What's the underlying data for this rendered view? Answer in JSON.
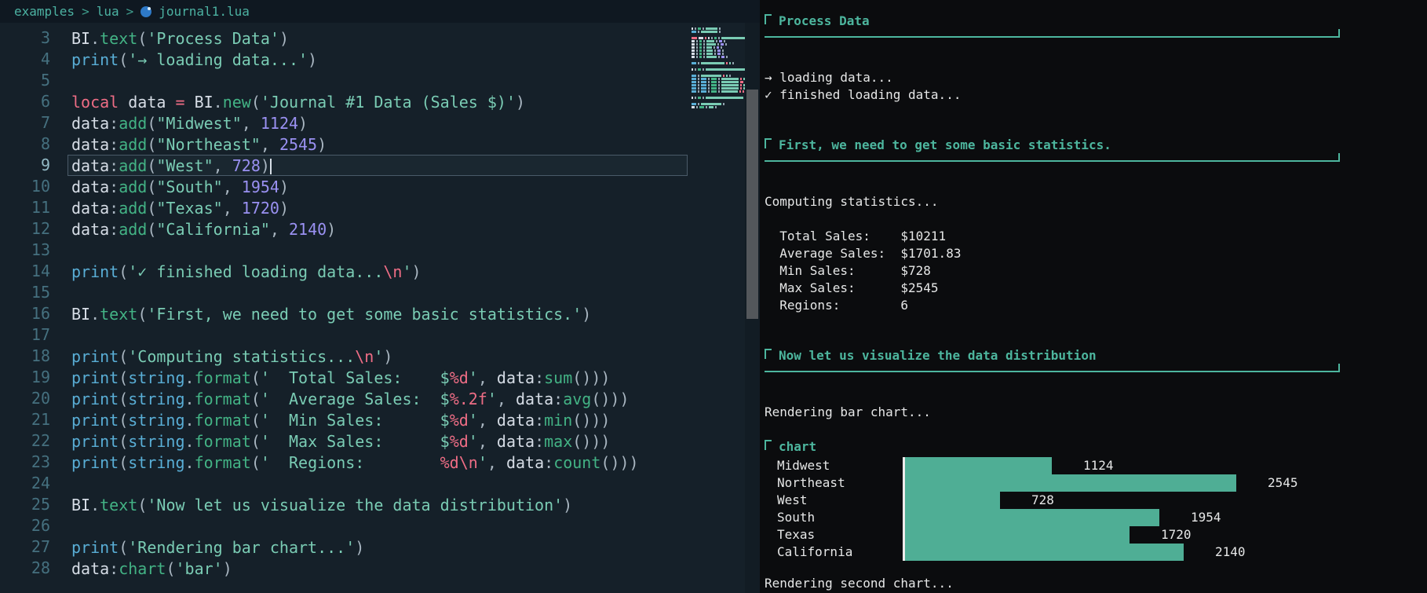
{
  "theme": {
    "editor_bg": "#152029",
    "output_bg": "#0b0c0e",
    "accent_teal": "#4db69e",
    "bar_color": "#4fae95",
    "keyword_pink": "#ee6d85",
    "function_green": "#43b385",
    "string_teal": "#7accb4",
    "builtin_blue": "#59aed6",
    "number_purple": "#9a91f2"
  },
  "breadcrumb": {
    "path": [
      "examples",
      "lua"
    ],
    "separator": ">",
    "file": "journal1.lua"
  },
  "editor": {
    "active_line": 9,
    "lines": [
      {
        "n": 3,
        "tokens": [
          [
            "id",
            "BI"
          ],
          [
            "p",
            "."
          ],
          [
            "fn",
            "text"
          ],
          [
            "p",
            "("
          ],
          [
            "str",
            "'Process Data'"
          ],
          [
            "p",
            ")"
          ]
        ]
      },
      {
        "n": 4,
        "tokens": [
          [
            "b",
            "print"
          ],
          [
            "p",
            "("
          ],
          [
            "str",
            "'→ loading data...'"
          ],
          [
            "p",
            ")"
          ]
        ]
      },
      {
        "n": 5,
        "tokens": []
      },
      {
        "n": 6,
        "tokens": [
          [
            "kw",
            "local "
          ],
          [
            "id",
            "data "
          ],
          [
            "kw",
            "= "
          ],
          [
            "id",
            "BI"
          ],
          [
            "p",
            "."
          ],
          [
            "fn",
            "new"
          ],
          [
            "p",
            "("
          ],
          [
            "str",
            "'Journal #1 Data (Sales $)'"
          ],
          [
            "p",
            ")"
          ]
        ]
      },
      {
        "n": 7,
        "tokens": [
          [
            "id",
            "data"
          ],
          [
            "p",
            ":"
          ],
          [
            "fn",
            "add"
          ],
          [
            "p",
            "("
          ],
          [
            "str",
            "\"Midwest\""
          ],
          [
            "p",
            ", "
          ],
          [
            "num",
            "1124"
          ],
          [
            "p",
            ")"
          ]
        ]
      },
      {
        "n": 8,
        "tokens": [
          [
            "id",
            "data"
          ],
          [
            "p",
            ":"
          ],
          [
            "fn",
            "add"
          ],
          [
            "p",
            "("
          ],
          [
            "str",
            "\"Northeast\""
          ],
          [
            "p",
            ", "
          ],
          [
            "num",
            "2545"
          ],
          [
            "p",
            ")"
          ]
        ]
      },
      {
        "n": 9,
        "cursor": true,
        "tokens": [
          [
            "id",
            "data"
          ],
          [
            "p",
            ":"
          ],
          [
            "fn",
            "add"
          ],
          [
            "p",
            "("
          ],
          [
            "str",
            "\"West\""
          ],
          [
            "p",
            ", "
          ],
          [
            "num",
            "728"
          ],
          [
            "p",
            ")"
          ]
        ]
      },
      {
        "n": 10,
        "tokens": [
          [
            "id",
            "data"
          ],
          [
            "p",
            ":"
          ],
          [
            "fn",
            "add"
          ],
          [
            "p",
            "("
          ],
          [
            "str",
            "\"South\""
          ],
          [
            "p",
            ", "
          ],
          [
            "num",
            "1954"
          ],
          [
            "p",
            ")"
          ]
        ]
      },
      {
        "n": 11,
        "tokens": [
          [
            "id",
            "data"
          ],
          [
            "p",
            ":"
          ],
          [
            "fn",
            "add"
          ],
          [
            "p",
            "("
          ],
          [
            "str",
            "\"Texas\""
          ],
          [
            "p",
            ", "
          ],
          [
            "num",
            "1720"
          ],
          [
            "p",
            ")"
          ]
        ]
      },
      {
        "n": 12,
        "tokens": [
          [
            "id",
            "data"
          ],
          [
            "p",
            ":"
          ],
          [
            "fn",
            "add"
          ],
          [
            "p",
            "("
          ],
          [
            "str",
            "\"California\""
          ],
          [
            "p",
            ", "
          ],
          [
            "num",
            "2140"
          ],
          [
            "p",
            ")"
          ]
        ]
      },
      {
        "n": 13,
        "tokens": []
      },
      {
        "n": 14,
        "tokens": [
          [
            "b",
            "print"
          ],
          [
            "p",
            "("
          ],
          [
            "str",
            "'✓ finished loading data..."
          ],
          [
            "esc",
            "\\n"
          ],
          [
            "str",
            "'"
          ],
          [
            "p",
            ")"
          ]
        ]
      },
      {
        "n": 15,
        "tokens": []
      },
      {
        "n": 16,
        "tokens": [
          [
            "id",
            "BI"
          ],
          [
            "p",
            "."
          ],
          [
            "fn",
            "text"
          ],
          [
            "p",
            "("
          ],
          [
            "str",
            "'First, we need to get some basic statistics.'"
          ],
          [
            "p",
            ")"
          ]
        ]
      },
      {
        "n": 17,
        "tokens": []
      },
      {
        "n": 18,
        "tokens": [
          [
            "b",
            "print"
          ],
          [
            "p",
            "("
          ],
          [
            "str",
            "'Computing statistics..."
          ],
          [
            "esc",
            "\\n"
          ],
          [
            "str",
            "'"
          ],
          [
            "p",
            ")"
          ]
        ]
      },
      {
        "n": 19,
        "tokens": [
          [
            "b",
            "print"
          ],
          [
            "p",
            "("
          ],
          [
            "b",
            "string"
          ],
          [
            "p",
            "."
          ],
          [
            "fn",
            "format"
          ],
          [
            "p",
            "("
          ],
          [
            "str",
            "'  Total Sales:    $"
          ],
          [
            "esc",
            "%d"
          ],
          [
            "str",
            "'"
          ],
          [
            "p",
            ", "
          ],
          [
            "id",
            "data"
          ],
          [
            "p",
            ":"
          ],
          [
            "fn",
            "sum"
          ],
          [
            "p",
            "()))"
          ]
        ]
      },
      {
        "n": 20,
        "tokens": [
          [
            "b",
            "print"
          ],
          [
            "p",
            "("
          ],
          [
            "b",
            "string"
          ],
          [
            "p",
            "."
          ],
          [
            "fn",
            "format"
          ],
          [
            "p",
            "("
          ],
          [
            "str",
            "'  Average Sales:  $"
          ],
          [
            "esc",
            "%.2f"
          ],
          [
            "str",
            "'"
          ],
          [
            "p",
            ", "
          ],
          [
            "id",
            "data"
          ],
          [
            "p",
            ":"
          ],
          [
            "fn",
            "avg"
          ],
          [
            "p",
            "()))"
          ]
        ]
      },
      {
        "n": 21,
        "tokens": [
          [
            "b",
            "print"
          ],
          [
            "p",
            "("
          ],
          [
            "b",
            "string"
          ],
          [
            "p",
            "."
          ],
          [
            "fn",
            "format"
          ],
          [
            "p",
            "("
          ],
          [
            "str",
            "'  Min Sales:      $"
          ],
          [
            "esc",
            "%d"
          ],
          [
            "str",
            "'"
          ],
          [
            "p",
            ", "
          ],
          [
            "id",
            "data"
          ],
          [
            "p",
            ":"
          ],
          [
            "fn",
            "min"
          ],
          [
            "p",
            "()))"
          ]
        ]
      },
      {
        "n": 22,
        "tokens": [
          [
            "b",
            "print"
          ],
          [
            "p",
            "("
          ],
          [
            "b",
            "string"
          ],
          [
            "p",
            "."
          ],
          [
            "fn",
            "format"
          ],
          [
            "p",
            "("
          ],
          [
            "str",
            "'  Max Sales:      $"
          ],
          [
            "esc",
            "%d"
          ],
          [
            "str",
            "'"
          ],
          [
            "p",
            ", "
          ],
          [
            "id",
            "data"
          ],
          [
            "p",
            ":"
          ],
          [
            "fn",
            "max"
          ],
          [
            "p",
            "()))"
          ]
        ]
      },
      {
        "n": 23,
        "tokens": [
          [
            "b",
            "print"
          ],
          [
            "p",
            "("
          ],
          [
            "b",
            "string"
          ],
          [
            "p",
            "."
          ],
          [
            "fn",
            "format"
          ],
          [
            "p",
            "("
          ],
          [
            "str",
            "'  Regions:        "
          ],
          [
            "esc",
            "%d"
          ],
          [
            "esc",
            "\\n"
          ],
          [
            "str",
            "'"
          ],
          [
            "p",
            ", "
          ],
          [
            "id",
            "data"
          ],
          [
            "p",
            ":"
          ],
          [
            "fn",
            "count"
          ],
          [
            "p",
            "()))"
          ]
        ]
      },
      {
        "n": 24,
        "tokens": []
      },
      {
        "n": 25,
        "tokens": [
          [
            "id",
            "BI"
          ],
          [
            "p",
            "."
          ],
          [
            "fn",
            "text"
          ],
          [
            "p",
            "("
          ],
          [
            "str",
            "'Now let us visualize the data distribution'"
          ],
          [
            "p",
            ")"
          ]
        ]
      },
      {
        "n": 26,
        "tokens": []
      },
      {
        "n": 27,
        "tokens": [
          [
            "b",
            "print"
          ],
          [
            "p",
            "("
          ],
          [
            "str",
            "'Rendering bar chart...'"
          ],
          [
            "p",
            ")"
          ]
        ]
      },
      {
        "n": 28,
        "tokens": [
          [
            "id",
            "data"
          ],
          [
            "p",
            ":"
          ],
          [
            "fn",
            "chart"
          ],
          [
            "p",
            "("
          ],
          [
            "str",
            "'bar'"
          ],
          [
            "p",
            ")"
          ]
        ]
      }
    ]
  },
  "output": {
    "blocks": [
      {
        "type": "header",
        "text": "Process Data"
      },
      {
        "type": "text",
        "lines": [
          "→ loading data...",
          "✓ finished loading data..."
        ]
      },
      {
        "type": "header",
        "text": "First, we need to get some basic statistics."
      },
      {
        "type": "text",
        "lines": [
          "Computing statistics..."
        ]
      },
      {
        "type": "text",
        "lines": [
          "  Total Sales:    $10211",
          "  Average Sales:  $1701.83",
          "  Min Sales:      $728",
          "  Max Sales:      $2545",
          "  Regions:        6"
        ]
      },
      {
        "type": "header",
        "text": "Now let us visualize the data distribution"
      },
      {
        "type": "text",
        "lines": [
          "Rendering bar chart..."
        ]
      },
      {
        "type": "chart"
      },
      {
        "type": "text",
        "lines": [
          "Rendering second chart..."
        ]
      }
    ]
  },
  "chart_data": {
    "type": "bar",
    "orientation": "horizontal",
    "title": "chart",
    "categories": [
      "Midwest",
      "Northeast",
      "West",
      "South",
      "Texas",
      "California"
    ],
    "values": [
      1124,
      2545,
      728,
      1954,
      1720,
      2140
    ],
    "xlim": [
      0,
      2545
    ],
    "bar_color": "#4fae95",
    "axis_line": "left",
    "legend": "none"
  }
}
